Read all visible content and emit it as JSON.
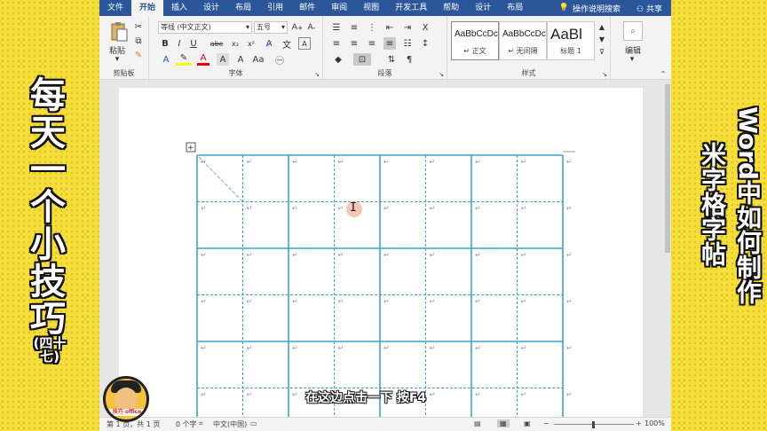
{
  "left_banner": {
    "title_chars": [
      "每",
      "天",
      "一",
      "个",
      "小",
      "技",
      "巧"
    ],
    "subtitle": "(四十七)"
  },
  "right_banner": {
    "line1": "Word中如何制作",
    "line2": "米字格字帖"
  },
  "avatar": {
    "label": "技巧 office"
  },
  "tabs": [
    {
      "label": "文件",
      "active": false
    },
    {
      "label": "开始",
      "active": true
    },
    {
      "label": "插入",
      "active": false
    },
    {
      "label": "设计",
      "active": false
    },
    {
      "label": "布局",
      "active": false
    },
    {
      "label": "引用",
      "active": false
    },
    {
      "label": "邮件",
      "active": false
    },
    {
      "label": "审阅",
      "active": false
    },
    {
      "label": "视图",
      "active": false
    },
    {
      "label": "开发工具",
      "active": false
    },
    {
      "label": "帮助",
      "active": false
    },
    {
      "label": "设计",
      "active": false
    },
    {
      "label": "布局",
      "active": false
    }
  ],
  "tell_me": "操作说明搜索",
  "share": "共享",
  "ribbon": {
    "clipboard": {
      "paste": "粘贴",
      "label": "剪贴板"
    },
    "font": {
      "name": "等线 (中文正文)",
      "size": "五号",
      "label": "字体",
      "bold": "B",
      "italic": "I",
      "underline": "U",
      "strike": "abc",
      "sub": "x₂",
      "sup": "x²"
    },
    "paragraph": {
      "label": "段落"
    },
    "styles": {
      "label": "样式",
      "items": [
        {
          "sample": "AaBbCcDc",
          "name": "↵ 正文"
        },
        {
          "sample": "AaBbCcDc",
          "name": "↵ 无间隔"
        },
        {
          "sample": "AaBl",
          "name": "标题 1"
        }
      ]
    },
    "editing": {
      "label": "编辑"
    }
  },
  "status": {
    "page": "第 1 页，共 1 页",
    "words": "0 个字",
    "lang": "中文(中国)",
    "zoom": "100%"
  },
  "caption": "在这边点击一下 按F4",
  "grid": {
    "rows": 3,
    "cols": 4,
    "cell_mark": "↵"
  },
  "colors": {
    "accent": "#2b579a",
    "grid": "#3aa6c8",
    "banner": "#f5dd3a"
  }
}
